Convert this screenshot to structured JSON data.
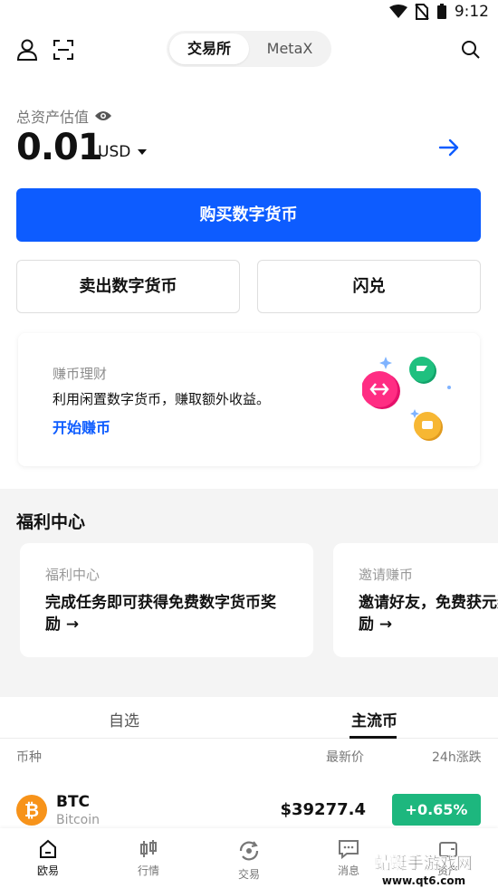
{
  "statusbar": {
    "time": "9:12"
  },
  "header": {
    "tabs": [
      {
        "label": "交易所"
      },
      {
        "label": "MetaX"
      }
    ]
  },
  "assets": {
    "label": "总资产估值",
    "value": "0.01",
    "currency": "USD"
  },
  "actions": {
    "buy": "购买数字货币",
    "sell": "卖出数字货币",
    "flash": "闪兑"
  },
  "earn": {
    "subtitle": "赚币理财",
    "description": "利用闲置数字货币，赚取额外收益。",
    "link": "开始赚币"
  },
  "welfare": {
    "title": "福利中心",
    "cards": [
      {
        "subtitle": "福利中心",
        "main": "完成任务即可获得免费数字货币奖励 →"
      },
      {
        "subtitle": "邀请赚币",
        "main": "邀请好友，免费获元奖励 →"
      }
    ]
  },
  "market": {
    "tabs": [
      {
        "label": "自选"
      },
      {
        "label": "主流币"
      }
    ],
    "columns": {
      "coin": "币种",
      "price": "最新价",
      "change": "24h涨跌"
    },
    "rows": [
      {
        "symbol": "BTC",
        "name": "Bitcoin",
        "icon": "₿",
        "price": "$39277.4",
        "change": "+0.65%"
      }
    ]
  },
  "bottom_nav": [
    {
      "label": "欧易",
      "icon": "home-icon"
    },
    {
      "label": "行情",
      "icon": "candlestick-icon"
    },
    {
      "label": "交易",
      "icon": "trade-icon"
    },
    {
      "label": "消息",
      "icon": "message-icon"
    },
    {
      "label": "资产",
      "icon": "wallet-icon"
    }
  ],
  "watermark": {
    "line1": "蜻蜓手游戏网",
    "line2": "www.qt6.com"
  },
  "colors": {
    "accent": "#0d5cff",
    "up": "#1db77e",
    "btc": "#f7931a"
  }
}
